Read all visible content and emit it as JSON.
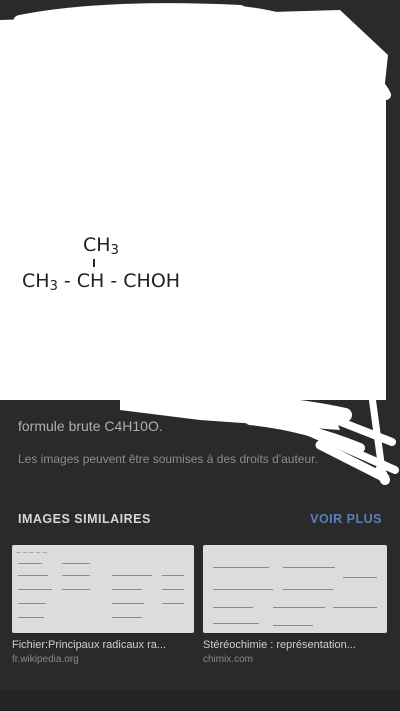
{
  "formula": {
    "methyl_top": "CH",
    "methyl_top_sub": "3",
    "chain_left": "CH",
    "chain_left_sub": "3",
    "chain_rest": " - CH - CHOH"
  },
  "caption": "formule brute C4H10O.",
  "copyright": "Les images peuvent être soumises à des droits d'auteur.",
  "similar": {
    "title": "IMAGES SIMILAIRES",
    "more_label": "VOIR PLUS",
    "items": [
      {
        "title": "Fichier:Principaux radicaux ra...",
        "source": "fr.wikipedia.org"
      },
      {
        "title": "Stéréochimie : représentation...",
        "source": "chimix.com"
      }
    ]
  },
  "colors": {
    "background": "#2a2a2a",
    "accent": "#5b7fbf",
    "overlay": "#ffffff"
  }
}
